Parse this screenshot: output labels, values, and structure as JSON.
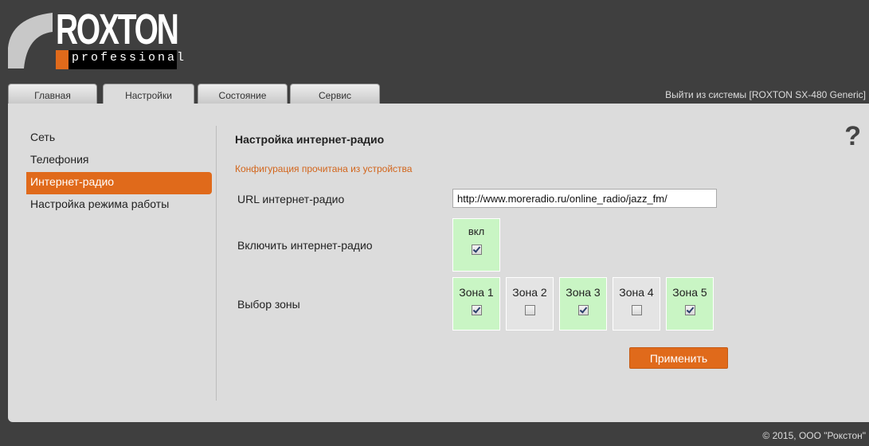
{
  "logo": {
    "brand": "ROXTON",
    "sub": "professional"
  },
  "tabs": [
    {
      "label": "Главная"
    },
    {
      "label": "Настройки"
    },
    {
      "label": "Состояние"
    },
    {
      "label": "Сервис"
    }
  ],
  "logout": "Выйти из системы [ROXTON SX-480 Generic]",
  "sidebar": {
    "items": [
      {
        "label": "Сеть"
      },
      {
        "label": "Телефония"
      },
      {
        "label": "Интернет-радио"
      },
      {
        "label": "Настройка режима работы"
      }
    ]
  },
  "content": {
    "title": "Настройка интернет-радио",
    "help": "?",
    "status": "Конфигурация прочитана из устройства",
    "url_label": "URL интернет-радио",
    "url_value": "http://www.moreradio.ru/online_radio/jazz_fm/",
    "enable_label": "Включить интернет-радио",
    "enable_box_label": "вкл",
    "zone_label": "Выбор зоны",
    "zones": [
      {
        "label": "Зона 1",
        "checked": true
      },
      {
        "label": "Зона 2",
        "checked": false
      },
      {
        "label": "Зона 3",
        "checked": true
      },
      {
        "label": "Зона 4",
        "checked": false
      },
      {
        "label": "Зона 5",
        "checked": true
      }
    ],
    "apply": "Применить"
  },
  "footer": "© 2015, ООО \"Рокстон\"",
  "colors": {
    "accent": "#e06a1b",
    "zone_on": "#c9f5c4",
    "panel": "#dcdcdc",
    "background": "#3f3f3f"
  }
}
